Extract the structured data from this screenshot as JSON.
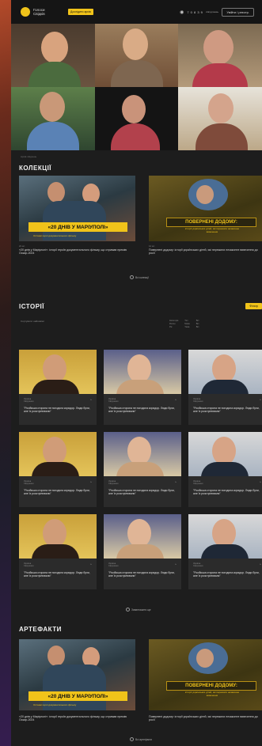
{
  "header": {
    "brand": "Голоси Свідків",
    "pill": "Дослідити архів",
    "stat": "7 0 8 3 9",
    "stat_sub": "свідчень",
    "button": "Увійти / реєстр."
  },
  "hero_meta": "Архів свідчень",
  "collections": {
    "title": "КОЛЕКЦІЇ",
    "cards": [
      {
        "banner": "«20 ДНІВ У МАРІУПОЛІ»",
        "banner_sub": "Останні герої документального фільму",
        "meta": "21 шт.",
        "caption": "«20 днів у Маріуполі»: історії героїв документального фільму, що отримав премію Оскар-2024"
      },
      {
        "banner": "ПОВЕРНЕНІ ДОДОМУ:",
        "banner_sub": "історії українських дітей, які пережили незаконне вивезення",
        "meta": "14 шт.",
        "caption": "Повернені додому: історії українських дітей, які пережили незаконне вивезення до росії"
      }
    ],
    "more": "Всі колекції"
  },
  "stories": {
    "title": "ІСТОРІЇ",
    "button": "Фільтр",
    "filters": "Сортувати: найновіші",
    "filter_cols": [
      [
        "Категорія",
        "Регіон",
        "Рік"
      ],
      [
        "Тип",
        "Мова",
        "Тема"
      ],
      [
        "Всі",
        "Всі",
        "Всі"
      ]
    ],
    "items": [
      {
        "meta1": "Україна",
        "meta2": "Свідчення",
        "title": "\"Російська сторона не погодила коридор. Люди були, але їх розстрілювали\"",
        "flag": "▸"
      },
      {
        "meta1": "Україна",
        "meta2": "Свідчення",
        "title": "\"Російська сторона не погодила коридор. Люди були, але їх розстрілювали\"",
        "flag": "▸"
      },
      {
        "meta1": "Україна",
        "meta2": "Свідчення",
        "title": "\"Російська сторона не погодила коридор. Люди були, але їх розстрілювали\"",
        "flag": "▸"
      },
      {
        "meta1": "Україна",
        "meta2": "Свідчення",
        "title": "\"Російська сторона не погодила коридор. Люди були, але їх розстрілювали\"",
        "flag": "▸"
      },
      {
        "meta1": "Україна",
        "meta2": "Свідчення",
        "title": "\"Російська сторона не погодила коридор. Люди були, але їх розстрілювали\"",
        "flag": "▸"
      },
      {
        "meta1": "Україна",
        "meta2": "Свідчення",
        "title": "\"Російська сторона не погодила коридор. Люди були, але їх розстрілювали\"",
        "flag": "▸"
      },
      {
        "meta1": "Україна",
        "meta2": "Свідчення",
        "title": "\"Російська сторона не погодила коридор. Люди були, але їх розстрілювали\"",
        "flag": "▸"
      },
      {
        "meta1": "Україна",
        "meta2": "Свідчення",
        "title": "\"Російська сторона не погодила коридор. Люди були, але їх розстрілювали\"",
        "flag": "▸"
      },
      {
        "meta1": "Україна",
        "meta2": "Свідчення",
        "title": "\"Російська сторона не погодила коридор. Люди були, але їх розстрілювали\"",
        "flag": "▸"
      }
    ],
    "more": "Завантажити ще"
  },
  "artifacts": {
    "title": "АРТЕФАКТИ",
    "cards": [
      {
        "banner": "«20 ДНІВ У МАРІУПОЛІ»",
        "banner_sub": "Останні герої документального фільму",
        "caption": "«20 днів у Маріуполі»: історії героїв документального фільму, що отримав премію Оскар-2024"
      },
      {
        "banner": "ПОВЕРНЕНІ ДОДОМУ:",
        "banner_sub": "історії українських дітей, які пережили незаконне вивезення",
        "caption": "Повернені додому: історії українських дітей, які пережили незаконне вивезення до росії"
      }
    ],
    "more": "Всі артефакти"
  },
  "colors": {
    "accent": "#f0c31a",
    "bg": "#1d1d1d",
    "card": "#2b2b2b"
  }
}
